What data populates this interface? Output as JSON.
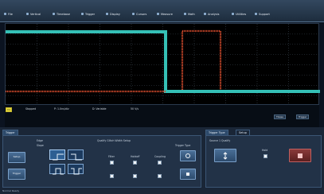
{
  "menu": {
    "items": [
      {
        "label": "File"
      },
      {
        "label": "Vertical"
      },
      {
        "label": "Timebase"
      },
      {
        "label": "Trigger"
      },
      {
        "label": "Display"
      },
      {
        "label": "Cursors"
      },
      {
        "label": "Measure"
      },
      {
        "label": "Math"
      },
      {
        "label": "Analysis"
      },
      {
        "label": "Utilities"
      },
      {
        "label": "Support"
      }
    ]
  },
  "scope": {
    "colors": {
      "ch1": "#35c0b6",
      "ch2": "#d04a2c",
      "grid": "#3b4652",
      "background": "#000000"
    }
  },
  "measurements": {
    "channel_label": "C1",
    "row1": [
      "Stopped",
      "P: 1.0ns/div",
      "D: Variable",
      "50 V/s"
    ],
    "readout_right": [
      "Tbase",
      "Trigger"
    ]
  },
  "trigger_panel": {
    "tab_label": "Trigger",
    "edge_label": "Edge",
    "slope_label": "Slope",
    "slope_options": [
      "Pos",
      "Neg",
      "Either",
      "Window"
    ],
    "middle_title": "Qualify Glitch Width Setup",
    "filter_labels": [
      "Filter",
      "Holdoff",
      "Coupling"
    ],
    "left_buttons": [
      "Setup",
      "Trigger"
    ],
    "right_label": "Trigger Type",
    "status": "Normal  Ready"
  },
  "right_panel": {
    "tabs": [
      "Trigger Type",
      "Setup"
    ],
    "sub_label": "Source 1 Qualify",
    "checkbox_label": "Hold",
    "buttons": [
      "Find Level",
      "Stop"
    ]
  }
}
